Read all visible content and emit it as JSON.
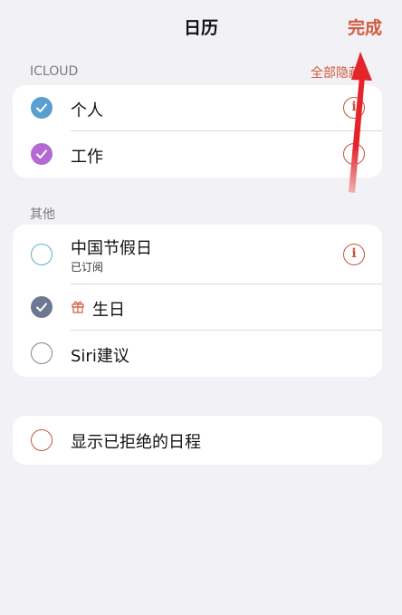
{
  "nav": {
    "title": "日历",
    "done_label": "完成"
  },
  "icloud": {
    "header": "ICLOUD",
    "hide_all_label": "全部隐藏",
    "items": [
      {
        "label": "个人",
        "checked": true,
        "color": "#5a9fd0"
      },
      {
        "label": "工作",
        "checked": true,
        "color": "#b46ad4"
      }
    ]
  },
  "other": {
    "header": "其他",
    "items": [
      {
        "label": "中国节假日",
        "sublabel": "已订阅",
        "checked": false,
        "color": "#5ab0c9"
      },
      {
        "label": "生日",
        "checked": true,
        "color": "#6d7893",
        "icon": "gift-icon"
      },
      {
        "label": "Siri建议",
        "checked": false,
        "color": "#7a8394"
      }
    ]
  },
  "declined": {
    "label": "显示已拒绝的日程",
    "checked": false,
    "color": "#c5533d"
  },
  "colors": {
    "accent": "#d15b3f",
    "arrow": "#e3242b"
  }
}
